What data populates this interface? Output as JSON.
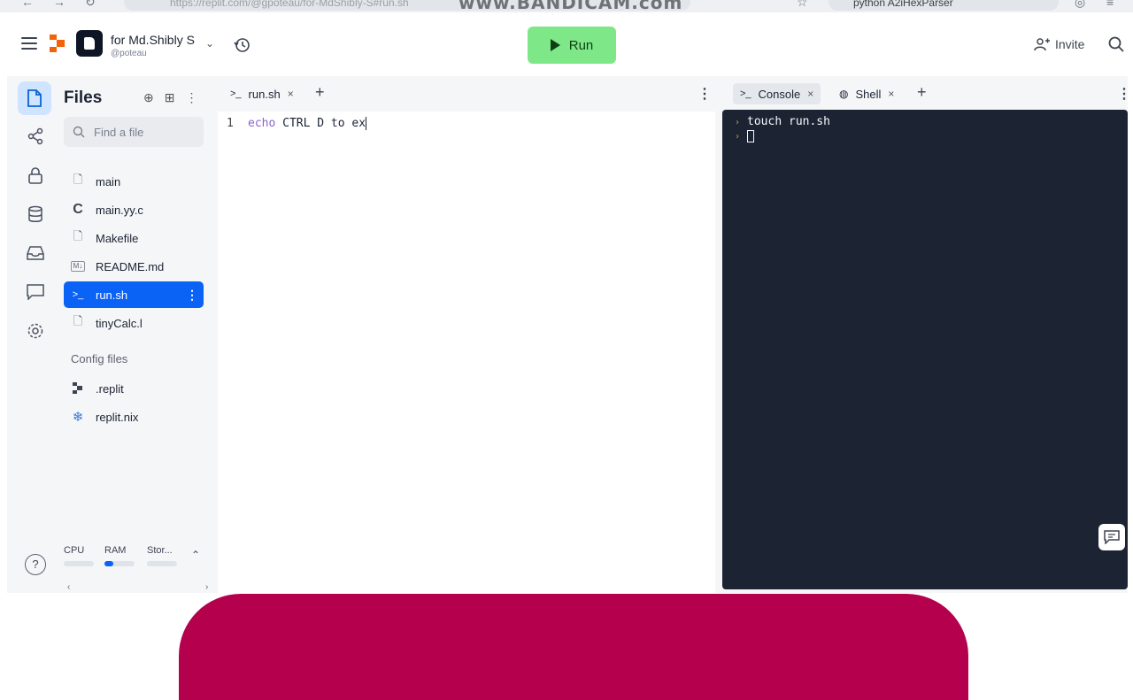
{
  "browser": {
    "url": "https://replit.com/@gpoteau/for-MdShibly-S#run.sh",
    "watermark": "www.BANDICAM.com",
    "search_text": "python A2iHexParser"
  },
  "header": {
    "repl_name": "for Md.Shibly S",
    "repl_owner": "@poteau",
    "run_label": "Run",
    "invite_label": "Invite"
  },
  "files": {
    "title": "Files",
    "search_placeholder": "Find a file",
    "items": [
      {
        "name": "main",
        "icon": "file-icon"
      },
      {
        "name": "main.yy.c",
        "icon": "c-lang-icon"
      },
      {
        "name": "Makefile",
        "icon": "file-icon"
      },
      {
        "name": "README.md",
        "icon": "markdown-icon"
      },
      {
        "name": "run.sh",
        "icon": "shell-icon",
        "selected": true
      },
      {
        "name": "tinyCalc.l",
        "icon": "file-icon"
      }
    ],
    "config_label": "Config files",
    "config_items": [
      {
        "name": ".replit",
        "icon": "replit-icon"
      },
      {
        "name": "replit.nix",
        "icon": "nix-icon"
      }
    ],
    "resources": {
      "cpu": "CPU",
      "ram": "RAM",
      "storage": "Stor...",
      "ram_usage": 0.3
    }
  },
  "editor": {
    "tab_label": "run.sh",
    "line_number": "1",
    "code_keyword": "echo",
    "code_rest": " CTRL D to ex"
  },
  "console": {
    "tab_console": "Console",
    "tab_shell": "Shell",
    "line1": "touch run.sh"
  },
  "colors": {
    "run_button": "#7ee787",
    "selected_file": "#0b63f6",
    "terminal_bg": "#1c2333",
    "pink_overlay": "#b5004e"
  }
}
